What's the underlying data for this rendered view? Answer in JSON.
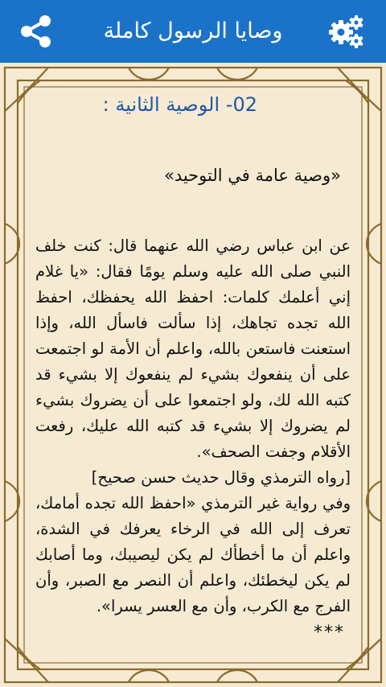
{
  "app": {
    "title": "وصايا الرسول كاملة",
    "share_icon": "share-icon",
    "settings_icon": "gear-icon",
    "accent": "#1a73c9",
    "page_bg": "#f6ebd2",
    "heading_color": "#1f57a7",
    "frame_color": "#8a6a2e"
  },
  "content": {
    "heading": "02- الوصية الثانية :",
    "subtitle": "«وصية عامة في التوحيد»",
    "paragraph_1": "عن ابن عباس رضي الله عنهما قال: كنت خلف النبي صلى الله عليه وسلم يومًا فقال: «يا غلام إني أعلمك كلمات: احفظ الله يحفظك، احفظ الله تجده تجاهك، إذا سألت فاسأل الله، وإذا استعنت فاستعن بالله، واعلم أن الأمة لو اجتمعت على أن ينفعوك بشيء لم ينفعوك إلا بشيء قد كتبه الله لك، ولو اجتمعوا على أن يضروك بشيء لم يضروك إلا بشيء قد كتبه الله عليك، رفعت الأقلام وجفت الصحف».",
    "paragraph_2": "[رواه الترمذي وقال حديث حسن صحيح]",
    "paragraph_3": "وفي رواية غير الترمذي «احفظ الله تجده أمامك، تعرف إلى الله في الرخاء يعرفك في الشدة، واعلم أن ما أخطأك لم يكن ليصيبك، وما أصابك لم يكن ليخطئك، واعلم أن النصر مع الصبر، وأن الفرج مع الكرب، وأن مع العسر يسرا».",
    "separator": "***"
  }
}
